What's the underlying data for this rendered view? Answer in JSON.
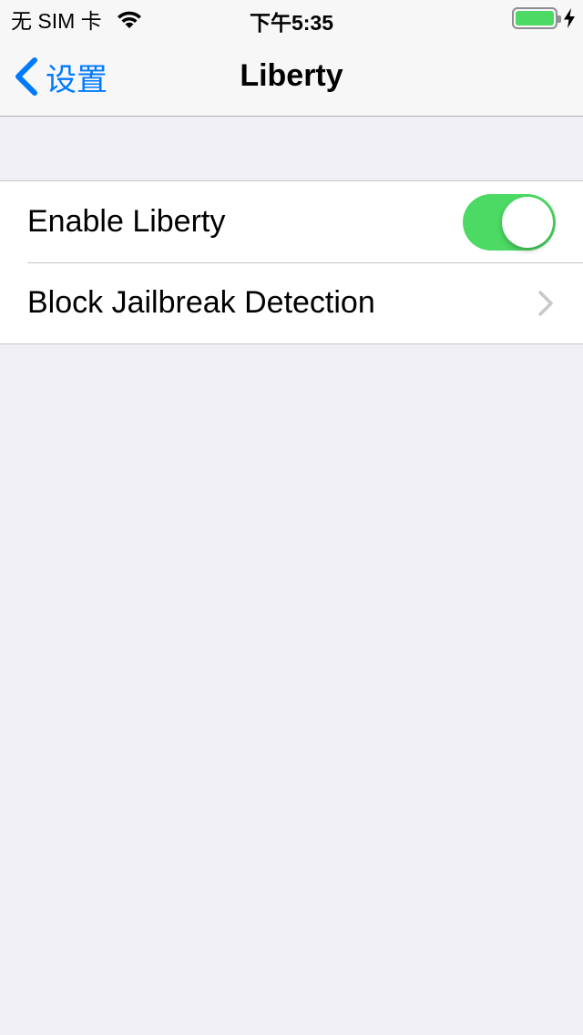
{
  "status_bar": {
    "carrier": "无 SIM 卡",
    "time": "下午5:35",
    "battery_level": 1.0,
    "charging": true
  },
  "nav": {
    "back_label": "设置",
    "title": "Liberty"
  },
  "cells": [
    {
      "label": "Enable Liberty",
      "accessory": "toggle",
      "toggle_on": true
    },
    {
      "label": "Block Jailbreak Detection",
      "accessory": "disclosure-chevron"
    }
  ],
  "colors": {
    "accent": "#007aff",
    "toggle_on": "#4cd964",
    "battery": "#4cd964",
    "background": "#efeff4"
  },
  "icons": [
    "wifi-icon",
    "battery-icon",
    "charging-bolt-icon",
    "back-chevron-icon",
    "chevron-right-icon"
  ]
}
